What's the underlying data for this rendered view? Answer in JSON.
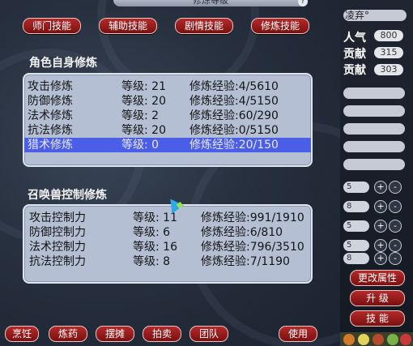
{
  "window": {
    "title": "修炼等级",
    "help_label": "?"
  },
  "tabs": [
    {
      "label": "师门技能"
    },
    {
      "label": "辅助技能"
    },
    {
      "label": "剧情技能"
    },
    {
      "label": "修炼技能"
    }
  ],
  "self_cultivation": {
    "title": "角色自身修炼",
    "rows": [
      {
        "name": "攻击修炼",
        "level": "等级: 21",
        "exp": "修炼经验:4/5610"
      },
      {
        "name": "防御修炼",
        "level": "等级: 20",
        "exp": "修炼经验:4/5150"
      },
      {
        "name": "法术修炼",
        "level": "等级:  2",
        "exp": "修炼经验:60/290"
      },
      {
        "name": "抗法修炼",
        "level": "等级: 20",
        "exp": "修炼经验:0/5150"
      },
      {
        "name": "猎术修炼",
        "level": "等级:  0",
        "exp": "修炼经验:20/150"
      }
    ]
  },
  "pet_cultivation": {
    "title": "召唤兽控制修炼",
    "rows": [
      {
        "name": "攻击控制力",
        "level": "等级: 11",
        "exp": "修炼经验:991/1910"
      },
      {
        "name": "防御控制力",
        "level": "等级:  6",
        "exp": "修炼经验:6/810"
      },
      {
        "name": "法术控制力",
        "level": "等级: 16",
        "exp": "修炼经验:796/3510"
      },
      {
        "name": "抗法控制力",
        "level": "等级:  8",
        "exp": "修炼经验:7/1190"
      }
    ]
  },
  "bottom_buttons": [
    {
      "label": "烹饪"
    },
    {
      "label": "炼药"
    },
    {
      "label": "摆摊"
    },
    {
      "label": "拍卖"
    },
    {
      "label": "团队"
    },
    {
      "label": "使用"
    }
  ],
  "right_panel": {
    "name_text": "凌弃°",
    "popularity": {
      "label": "人气",
      "value": "800"
    },
    "contrib1": {
      "label": "贡献",
      "value": "315"
    },
    "contrib2": {
      "label": "贡献",
      "value": "303"
    },
    "attr_values": [
      "5",
      "8",
      "5",
      "5",
      "8",
      "5"
    ],
    "buttons": {
      "change_attr": "更改属性",
      "upgrade": "升 级",
      "skills": "技 能"
    },
    "plus": "+",
    "minus": "-"
  }
}
